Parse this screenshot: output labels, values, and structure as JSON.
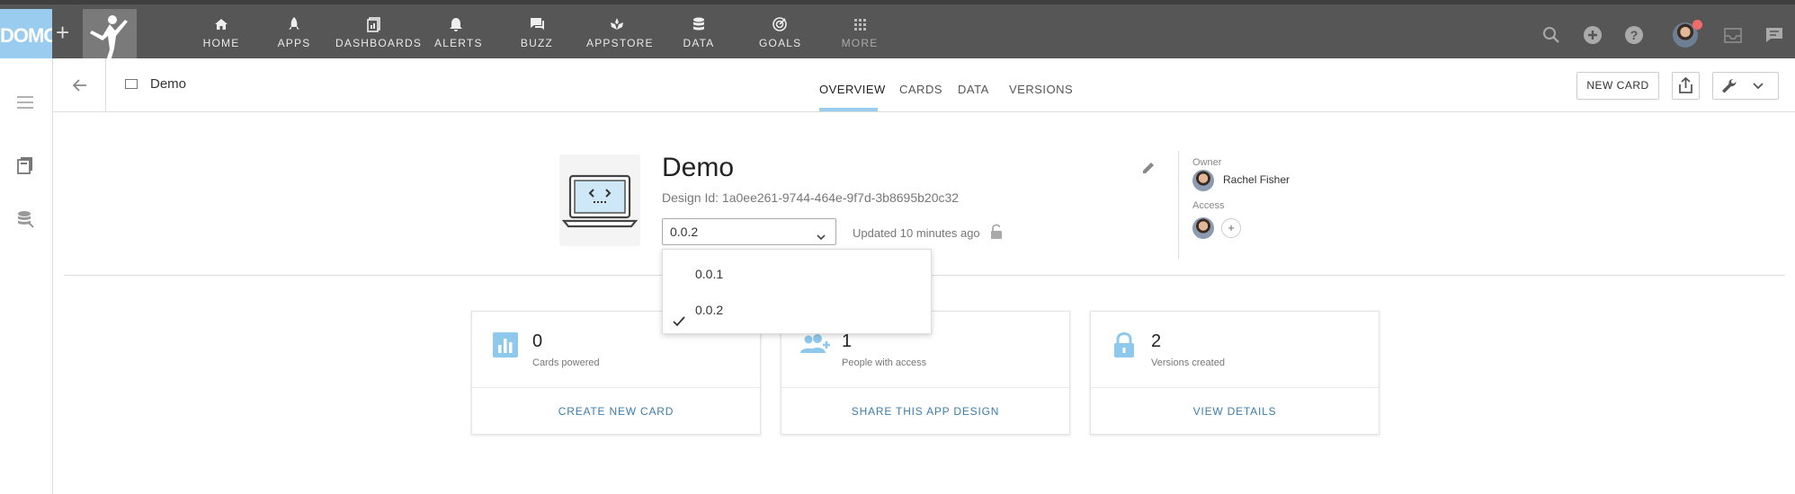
{
  "app": {
    "logo_text": "DOMO",
    "nav": [
      {
        "label": "HOME",
        "icon": "home-icon"
      },
      {
        "label": "APPS",
        "icon": "rocket-icon"
      },
      {
        "label": "DASHBOARDS",
        "icon": "dashboards-icon"
      },
      {
        "label": "ALERTS",
        "icon": "bell-icon"
      },
      {
        "label": "BUZZ",
        "icon": "chat-icon"
      },
      {
        "label": "APPSTORE",
        "icon": "appstore-icon"
      },
      {
        "label": "DATA",
        "icon": "database-icon"
      },
      {
        "label": "GOALS",
        "icon": "target-icon"
      },
      {
        "label": "MORE",
        "icon": "grid-icon"
      }
    ],
    "colors": {
      "topbar": "#565656",
      "logo_bg": "#99ccee",
      "accent": "#99ccee",
      "link": "#3d7eaa",
      "notification": "#f26b6b"
    }
  },
  "header": {
    "title": "Demo",
    "tabs": [
      "OVERVIEW",
      "CARDS",
      "DATA",
      "VERSIONS"
    ],
    "active_tab": "OVERVIEW",
    "new_card_label": "NEW CARD"
  },
  "design": {
    "name": "Demo",
    "design_id": "Design Id: 1a0ee261-9744-464e-9f7d-3b8695b20c32",
    "selected_version": "0.0.2",
    "updated": "Updated 10 minutes ago",
    "owner_label": "Owner",
    "owner_name": "Rachel Fisher",
    "access_label": "Access",
    "access_add": "+"
  },
  "version_dropdown": {
    "options": [
      "0.0.1",
      "0.0.2"
    ],
    "checked": "0.0.2"
  },
  "stats": [
    {
      "value": "0",
      "label": "Cards powered",
      "action": "CREATE NEW CARD",
      "icon": "bar-chart-icon"
    },
    {
      "value": "1",
      "label": "People with access",
      "action": "SHARE THIS APP DESIGN",
      "icon": "add-people-icon"
    },
    {
      "value": "2",
      "label": "Versions created",
      "action": "VIEW DETAILS",
      "icon": "lock-icon"
    }
  ]
}
